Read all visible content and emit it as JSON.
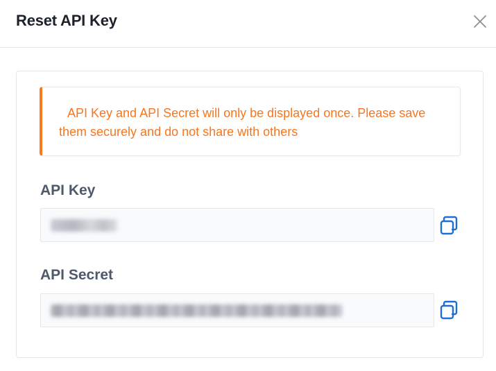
{
  "dialog": {
    "title": "Reset API Key",
    "close_icon": "close-icon"
  },
  "alert": {
    "text": "API Key and API Secret will only be displayed once. Please save them securely and do not share with others",
    "accent_color": "#f77a1b"
  },
  "fields": {
    "api_key": {
      "label": "API Key",
      "value_masked": true,
      "copy_icon": "copy-icon"
    },
    "api_secret": {
      "label": "API Secret",
      "value_masked": true,
      "copy_icon": "copy-icon"
    }
  },
  "colors": {
    "copy_icon": "#1d6fd8",
    "label": "#4e5969"
  }
}
